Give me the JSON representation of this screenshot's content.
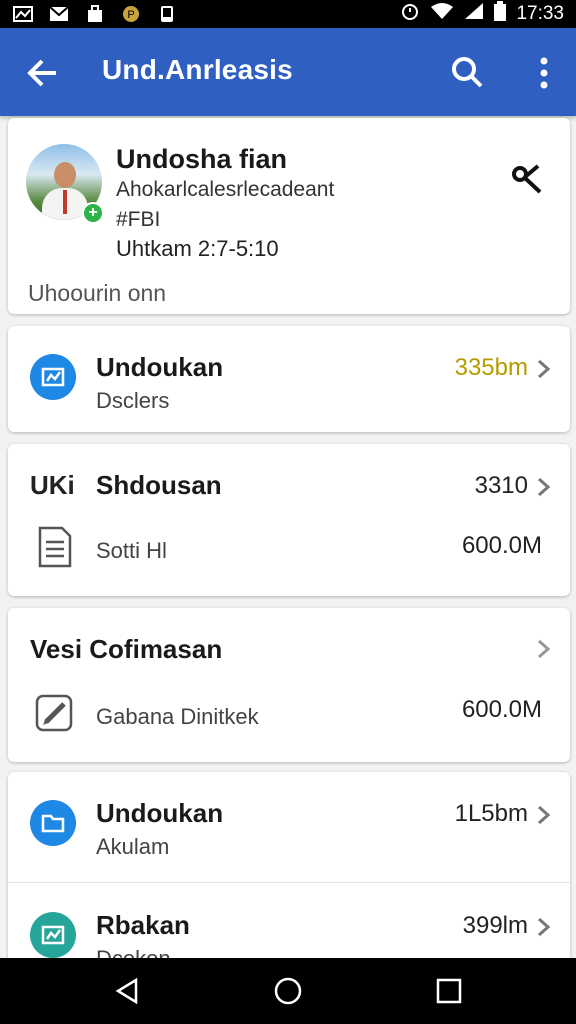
{
  "status_bar": {
    "time": "17:33",
    "left_icons": [
      "chart-icon",
      "mail-icon",
      "bag-icon",
      "coin-icon",
      "phone-icon"
    ],
    "right_icons": [
      "alarm-icon",
      "wifi-icon",
      "signal-icon",
      "battery-icon"
    ]
  },
  "app_bar": {
    "title": "Und.Anrleasis",
    "color": "#2f5fc0"
  },
  "profile": {
    "name": "Undosha fian",
    "subtitle": "Ahokarlcalesrlecadeant",
    "id": "#FBI",
    "time": "Uhtkam 2:7-5:10",
    "footer": "Uhoourin onn"
  },
  "items": [
    {
      "title": "Undoukan",
      "sub": "Dsclers",
      "value": "335bm",
      "icon": "chart-icon",
      "value_color": "#b59a00"
    },
    {
      "prefix": "UKi",
      "title": "Shdousan",
      "value": "3310",
      "sub": "Sotti Hl",
      "sub_value": "600.0M",
      "sub_icon": "document-icon"
    },
    {
      "title": "Vesi Cofimasan",
      "sub": "Gabana Dinitkek",
      "sub_value": "600.0M",
      "sub_icon": "edit-icon"
    },
    {
      "title": "Undoukan",
      "sub": "Akulam",
      "value": "1L5bm",
      "icon": "folder-icon"
    },
    {
      "title": "Rbakan",
      "sub": "Dcokon",
      "value": "399lm",
      "icon": "chart-icon"
    }
  ],
  "nav": [
    "back-nav-icon",
    "home-nav-icon",
    "recents-nav-icon"
  ]
}
